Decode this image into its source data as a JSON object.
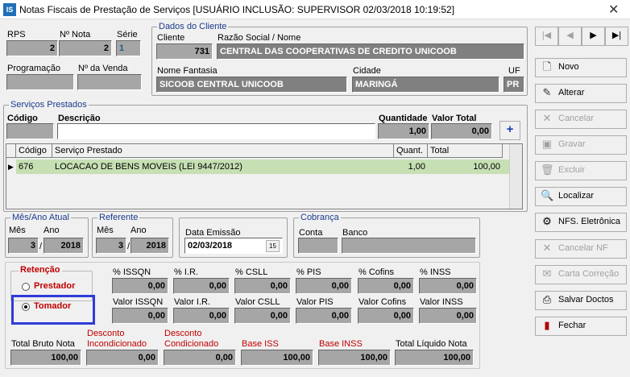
{
  "window": {
    "title": "Notas Fiscais de Prestação de Serviços  [USUÁRIO INCLUSÃO: SUPERVISOR 02/03/2018 10:19:52]",
    "app_icon": "IS",
    "close_glyph": "✕"
  },
  "header": {
    "rps_label": "RPS",
    "rps_value": "2",
    "nota_label": "Nº Nota",
    "nota_value": "2",
    "serie_label": "Série",
    "serie_value": "1",
    "programacao_label": "Programação",
    "programacao_value": "",
    "venda_label": "Nº da Venda",
    "venda_value": ""
  },
  "cliente": {
    "group_label": "Dados do Cliente",
    "cliente_label": "Cliente",
    "cliente_value": "731",
    "razao_label": "Razão Social / Nome",
    "razao_value": "CENTRAL DAS COOPERATIVAS DE CREDITO UNICOOB",
    "fantasia_label": "Nome Fantasia",
    "fantasia_value": "SICOOB CENTRAL UNICOOB",
    "cidade_label": "Cidade",
    "cidade_value": "MARINGÁ",
    "uf_label": "UF",
    "uf_value": "PR"
  },
  "servicos": {
    "group_label": "Serviços Prestados",
    "codigo_label": "Código",
    "codigo_value": "",
    "descricao_label": "Descrição",
    "descricao_value": "",
    "quantidade_label": "Quantidade",
    "quantidade_value": "1,00",
    "valor_total_label": "Valor Total",
    "valor_total_value": "0,00",
    "add_glyph": "+",
    "columns": [
      "Código",
      "Serviço Prestado",
      "Quant.",
      "Total"
    ],
    "rows": [
      {
        "codigo": "676",
        "servico": "LOCACAO DE BENS MOVEIS (LEI 9447/2012)",
        "quant": "1,00",
        "total": "100,00"
      }
    ]
  },
  "mes_ano": {
    "group_label": "Mês/Ano Atual",
    "mes_label": "Mês",
    "mes_value": "3",
    "ano_label": "Ano",
    "ano_value": "2018",
    "sep": "/"
  },
  "referente": {
    "group_label": "Referente",
    "mes_label": "Mês",
    "mes_value": "3",
    "ano_label": "Ano",
    "ano_value": "2018",
    "sep": "/"
  },
  "emissao": {
    "label": "Data Emissão",
    "value": "02/03/2018",
    "cal_glyph": "15"
  },
  "cobranca": {
    "group_label": "Cobrança",
    "conta_label": "Conta",
    "conta_value": "",
    "banco_label": "Banco",
    "banco_value": ""
  },
  "retencao": {
    "label": "Retenção",
    "options": [
      "Prestador",
      "Tomador"
    ],
    "selected": "Tomador"
  },
  "impostos": {
    "pct": [
      {
        "label": "% ISSQN",
        "value": "0,00"
      },
      {
        "label": "% I.R.",
        "value": "0,00"
      },
      {
        "label": "% CSLL",
        "value": "0,00"
      },
      {
        "label": "% PIS",
        "value": "0,00"
      },
      {
        "label": "% Cofins",
        "value": "0,00"
      },
      {
        "label": "% INSS",
        "value": "0,00"
      }
    ],
    "val": [
      {
        "label": "Valor ISSQN",
        "value": "0,00"
      },
      {
        "label": "Valor I.R.",
        "value": "0,00"
      },
      {
        "label": "Valor CSLL",
        "value": "0,00"
      },
      {
        "label": "Valor PIS",
        "value": "0,00"
      },
      {
        "label": "Valor Cofins",
        "value": "0,00"
      },
      {
        "label": "Valor INSS",
        "value": "0,00"
      }
    ]
  },
  "totais": {
    "bruto_label": "Total Bruto Nota",
    "bruto_value": "100,00",
    "desc_incond_label1": "Desconto",
    "desc_incond_label2": "Incondicionado",
    "desc_incond_value": "0,00",
    "desc_cond_label1": "Desconto",
    "desc_cond_label2": "Condicionado",
    "desc_cond_value": "0,00",
    "base_iss_label": "Base ISS",
    "base_iss_value": "100,00",
    "base_inss_label": "Base INSS",
    "base_inss_value": "100,00",
    "liquido_label": "Total Líquido Nota",
    "liquido_value": "100,00"
  },
  "nav": {
    "first": "|◀",
    "prev": "◀",
    "next": "▶",
    "last": "▶|"
  },
  "actions": [
    {
      "label": "Novo",
      "icon": "new-document-icon",
      "glyph": "🗋",
      "enabled": true
    },
    {
      "label": "Alterar",
      "icon": "edit-document-icon",
      "glyph": "✎",
      "enabled": true
    },
    {
      "label": "Cancelar",
      "icon": "cancel-icon",
      "glyph": "✕",
      "enabled": false
    },
    {
      "label": "Gravar",
      "icon": "save-icon",
      "glyph": "▣",
      "enabled": false
    },
    {
      "label": "Excluir",
      "icon": "trash-icon",
      "glyph": "🗑",
      "enabled": false
    },
    {
      "label": "Localizar",
      "icon": "search-icon",
      "glyph": "🔍",
      "enabled": true
    },
    {
      "label": "NFS. Eletrônica",
      "icon": "nfs-icon",
      "glyph": "⚙",
      "enabled": true
    },
    {
      "label": "Cancelar NF",
      "icon": "cancel-nf-icon",
      "glyph": "✕",
      "enabled": false
    },
    {
      "label": "Carta Correção",
      "icon": "letter-icon",
      "glyph": "✉",
      "enabled": false
    },
    {
      "label": "Salvar Doctos",
      "icon": "printer-icon",
      "glyph": "⎙",
      "enabled": true
    },
    {
      "label": "Fechar",
      "icon": "exit-door-icon",
      "glyph": "▮",
      "enabled": true
    }
  ],
  "colors": {
    "field_gray": "#a6a6a6",
    "field_dark": "#808080",
    "row_green": "#c6e0b4",
    "group_label_blue": "#1a3b8c",
    "red_label": "#c00000",
    "highlight_border": "#2e3bd8"
  }
}
